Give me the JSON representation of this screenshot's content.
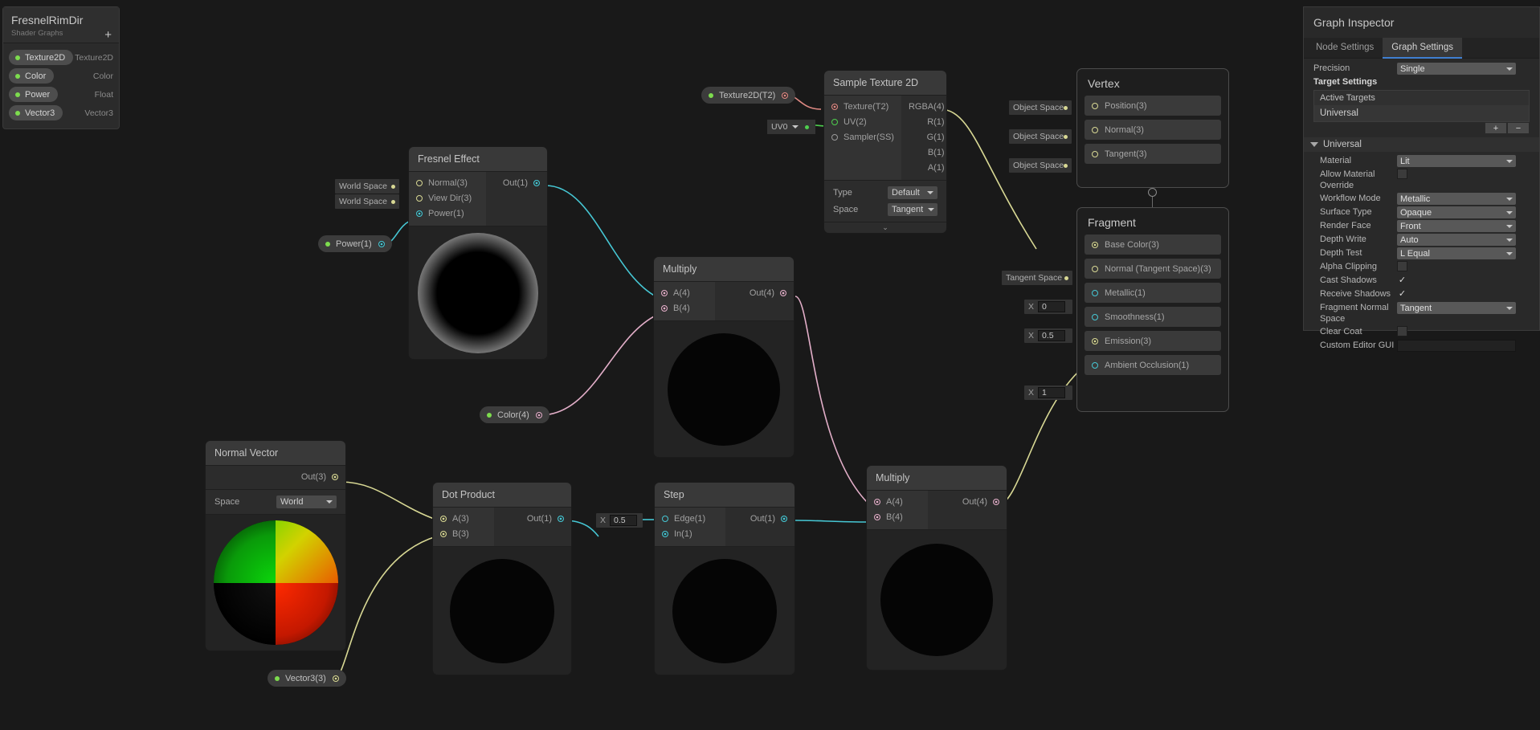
{
  "blackboard": {
    "title": "FresnelRimDir",
    "subtitle": "Shader Graphs",
    "add_label": "+",
    "properties": [
      {
        "name": "Texture2D",
        "type": "Texture2D"
      },
      {
        "name": "Color",
        "type": "Color"
      },
      {
        "name": "Power",
        "type": "Float"
      },
      {
        "name": "Vector3",
        "type": "Vector3"
      }
    ]
  },
  "inspector": {
    "title": "Graph Inspector",
    "tabs": [
      {
        "label": "Node Settings",
        "active": false
      },
      {
        "label": "Graph Settings",
        "active": true
      }
    ],
    "precision_label": "Precision",
    "precision_value": "Single",
    "target_settings_label": "Target Settings",
    "active_targets_label": "Active Targets",
    "active_targets": [
      "Universal"
    ],
    "add_target_label": "+",
    "remove_target_label": "−",
    "foldout_label": "Universal",
    "rows": [
      {
        "key": "Material",
        "kind": "dropdown",
        "value": "Lit"
      },
      {
        "key": "Allow Material Override",
        "kind": "checkbox",
        "value": false
      },
      {
        "key": "Workflow Mode",
        "kind": "dropdown",
        "value": "Metallic"
      },
      {
        "key": "Surface Type",
        "kind": "dropdown",
        "value": "Opaque"
      },
      {
        "key": "Render Face",
        "kind": "dropdown",
        "value": "Front"
      },
      {
        "key": "Depth Write",
        "kind": "dropdown",
        "value": "Auto"
      },
      {
        "key": "Depth Test",
        "kind": "dropdown",
        "value": "L Equal"
      },
      {
        "key": "Alpha Clipping",
        "kind": "checkbox",
        "value": false
      },
      {
        "key": "Cast Shadows",
        "kind": "checkbox",
        "value": true
      },
      {
        "key": "Receive Shadows",
        "kind": "checkbox",
        "value": true
      },
      {
        "key": "Fragment Normal Space",
        "kind": "dropdown",
        "value": "Tangent"
      },
      {
        "key": "Clear Coat",
        "kind": "checkbox",
        "value": false
      },
      {
        "key": "Custom Editor GUI",
        "kind": "text",
        "value": ""
      }
    ],
    "checked_glyph": "✓"
  },
  "nodes": {
    "fresnel": {
      "title": "Fresnel Effect",
      "inputs": [
        "Normal(3)",
        "View Dir(3)",
        "Power(1)"
      ],
      "outputs": [
        "Out(1)"
      ],
      "input_chips": [
        "World Space",
        "World Space"
      ]
    },
    "sample_texture": {
      "title": "Sample Texture 2D",
      "inputs": [
        "Texture(T2)",
        "UV(2)",
        "Sampler(SS)"
      ],
      "outputs": [
        "RGBA(4)",
        "R(1)",
        "G(1)",
        "B(1)",
        "A(1)"
      ],
      "settings": [
        {
          "label": "Type",
          "value": "Default"
        },
        {
          "label": "Space",
          "value": "Tangent"
        }
      ],
      "collapse_glyph": "⌄"
    },
    "multiply_top": {
      "title": "Multiply",
      "inputs": [
        "A(4)",
        "B(4)"
      ],
      "outputs": [
        "Out(4)"
      ]
    },
    "multiply_bottom": {
      "title": "Multiply",
      "inputs": [
        "A(4)",
        "B(4)"
      ],
      "outputs": [
        "Out(4)"
      ]
    },
    "normal_vector": {
      "title": "Normal Vector",
      "inputs": [],
      "outputs": [
        "Out(3)"
      ],
      "settings": [
        {
          "label": "Space",
          "value": "World"
        }
      ]
    },
    "dot_product": {
      "title": "Dot Product",
      "inputs": [
        "A(3)",
        "B(3)"
      ],
      "outputs": [
        "Out(1)"
      ]
    },
    "step": {
      "title": "Step",
      "inputs": [
        "Edge(1)",
        "In(1)"
      ],
      "outputs": [
        "Out(1)"
      ],
      "edge_value": "0.5",
      "edge_axis": "X"
    },
    "vertex": {
      "title": "Vertex",
      "slots": [
        "Position(3)",
        "Normal(3)",
        "Tangent(3)"
      ],
      "chips": [
        "Object Space",
        "Object Space",
        "Object Space"
      ]
    },
    "fragment": {
      "title": "Fragment",
      "slots": [
        "Base Color(3)",
        "Normal (Tangent Space)(3)",
        "Metallic(1)",
        "Smoothness(1)",
        "Emission(3)",
        "Ambient Occlusion(1)"
      ],
      "chips": [
        {
          "type": "none"
        },
        {
          "type": "space",
          "value": "Tangent Space"
        },
        {
          "type": "float",
          "axis": "X",
          "value": "0"
        },
        {
          "type": "float",
          "axis": "X",
          "value": "0.5"
        },
        {
          "type": "none"
        },
        {
          "type": "float",
          "axis": "X",
          "value": "1"
        }
      ]
    }
  },
  "property_nodes": [
    {
      "id": "texture2d_t2",
      "label": "Texture2D(T2)"
    },
    {
      "id": "power_1",
      "label": "Power(1)"
    },
    {
      "id": "color_4",
      "label": "Color(4)"
    },
    {
      "id": "vector3_3",
      "label": "Vector3(3)"
    },
    {
      "id": "uv0",
      "label": "UV0"
    }
  ],
  "colors": {
    "accent_tab": "#3f7fd0",
    "wire_yellow": "#d8d894",
    "wire_cyan": "#46c7d4",
    "wire_pink": "#e2aec8",
    "wire_red": "#e08a84",
    "wire_green": "#4ecf4e",
    "property_green": "#7ddc4e",
    "bg": "#191919"
  }
}
